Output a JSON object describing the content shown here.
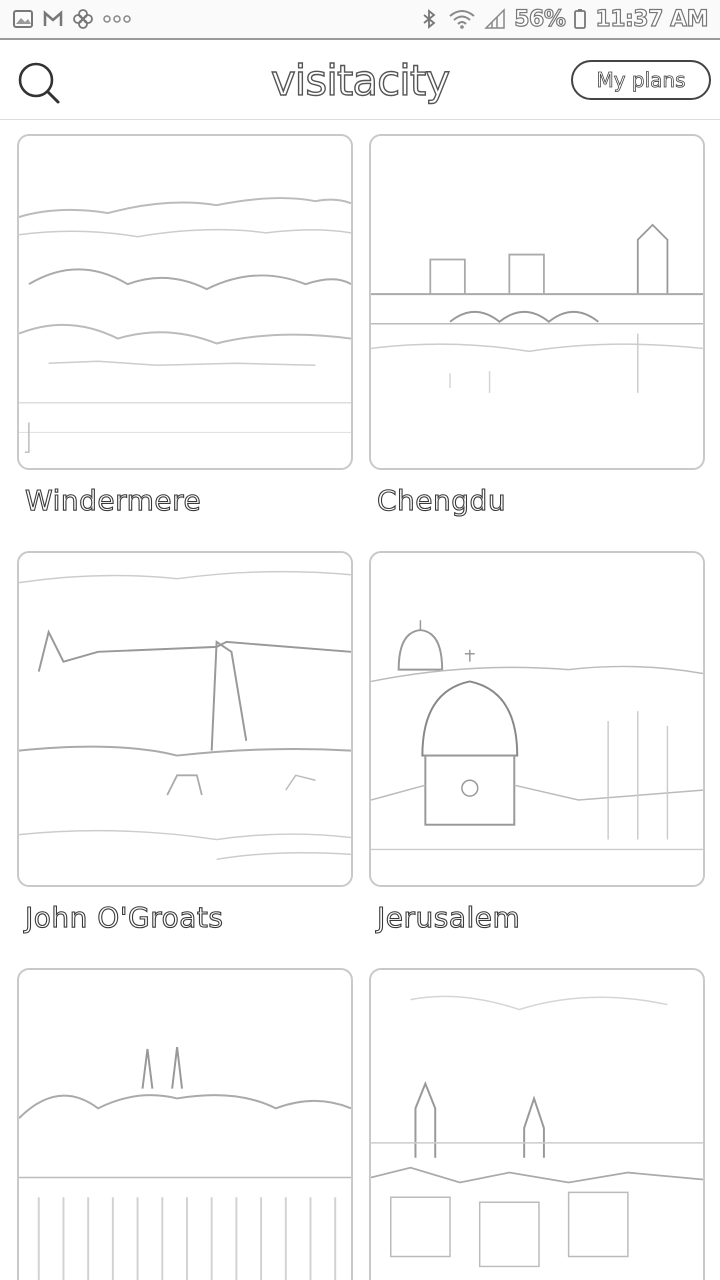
{
  "status_bar": {
    "battery": "56%",
    "time": "11:37 AM",
    "icons": [
      "gallery-icon",
      "gmail-icon",
      "flower-icon",
      "more-dots-icon",
      "bluetooth-icon",
      "wifi-icon",
      "signal-icon",
      "battery-icon"
    ]
  },
  "header": {
    "logo": "visitacity",
    "plans_button": "My plans",
    "search_icon": "search-icon"
  },
  "cities": [
    {
      "name": "Windermere",
      "scene": "lake"
    },
    {
      "name": "Chengdu",
      "scene": "bridge"
    },
    {
      "name": "John O'Groats",
      "scene": "cliffs"
    },
    {
      "name": "Jerusalem",
      "scene": "domes"
    },
    {
      "name": "",
      "scene": "spires"
    },
    {
      "name": "",
      "scene": "towers"
    }
  ]
}
